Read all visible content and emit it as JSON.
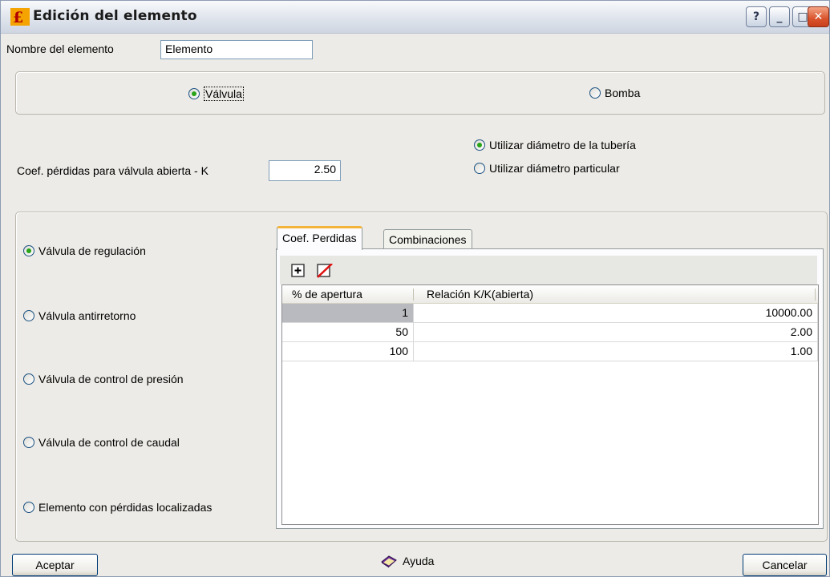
{
  "window": {
    "title": "Edición del elemento",
    "help_glyph": "?",
    "minimize_glyph": "_",
    "maximize_glyph": "□",
    "close_glyph": "✕"
  },
  "element_name": {
    "label": "Nombre del elemento",
    "value": "Elemento"
  },
  "element_type": {
    "options": [
      "Válvula",
      "Bomba"
    ],
    "selected": "Válvula"
  },
  "coef": {
    "label": "Coef. pérdidas para válvula abierta - K",
    "value": "2.50"
  },
  "diameter": {
    "options": [
      "Utilizar diámetro de la tubería",
      "Utilizar diámetro particular"
    ],
    "selected": "Utilizar diámetro de la tubería"
  },
  "valve_types": {
    "options": [
      "Válvula de regulación",
      "Válvula antirretorno",
      "Válvula de control de presión",
      "Válvula de control de caudal",
      "Elemento con pérdidas localizadas"
    ],
    "selected": "Válvula de regulación"
  },
  "tabs": [
    {
      "label": "Coef. Perdidas",
      "active": true
    },
    {
      "label": "Combinaciones",
      "active": false
    }
  ],
  "grid": {
    "columns": [
      "% de apertura",
      "Relación K/K(abierta)"
    ],
    "rows": [
      [
        "1",
        "10000.00"
      ],
      [
        "50",
        "2.00"
      ],
      [
        "100",
        "1.00"
      ]
    ],
    "toolbar_icons": [
      "add-row-icon",
      "delete-row-icon"
    ]
  },
  "footer": {
    "accept": "Aceptar",
    "help": "Ayuda",
    "cancel": "Cancelar"
  },
  "colors": {
    "window_bg": "#ecebe7",
    "radio_on": "#27a418",
    "tab_active_accent": "#f4b43a",
    "close_button": "#d9532c"
  }
}
